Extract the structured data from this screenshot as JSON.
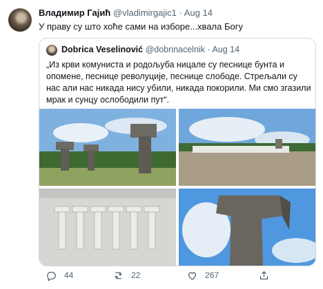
{
  "tweet": {
    "author_name": "Владимир Гајић",
    "author_handle": "@vladimirgajic1",
    "separator": "·",
    "date": "Aug 14",
    "text": "У праву су што хоће сами на изборе...хвала Богу"
  },
  "quoted_tweet": {
    "author_name": "Dobrica Veselinović",
    "author_handle": "@dobrinacelnik",
    "separator": "·",
    "date": "Aug 14",
    "text": "„Из крви комуниста и родољуба ницале су песнице бунта и опомене, песнице револуције, песнице слободе. Стрељали су нас али нас никада нису убили, никада покорили. Ми смо згазили мрак и сунцу ослободили пут“."
  },
  "actions": {
    "replies": "44",
    "retweets": "22",
    "likes": "267"
  },
  "icons": [
    "reply-icon",
    "retweet-icon",
    "like-icon",
    "share-icon"
  ]
}
